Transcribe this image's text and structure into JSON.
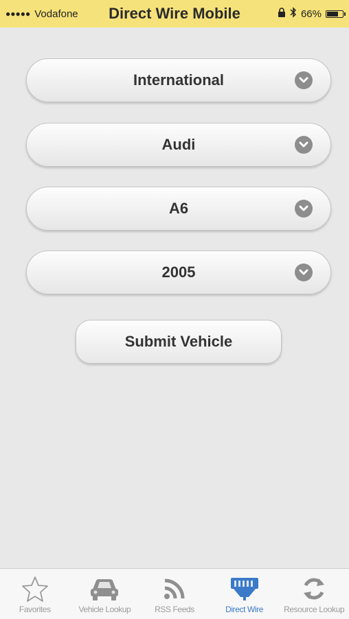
{
  "status_bar": {
    "signal": "●●●●●",
    "carrier": "Vodafone",
    "battery_text": "66%"
  },
  "app_title": "Direct Wire Mobile",
  "dropdowns": [
    {
      "label": "International"
    },
    {
      "label": "Audi"
    },
    {
      "label": "A6"
    },
    {
      "label": "2005"
    }
  ],
  "submit_button": "Submit Vehicle",
  "tabs": [
    {
      "label": "Favorites",
      "icon": "star-icon",
      "active": false
    },
    {
      "label": "Vehicle Lookup",
      "icon": "car-icon",
      "active": false
    },
    {
      "label": "RSS Feeds",
      "icon": "rss-icon",
      "active": false
    },
    {
      "label": "Direct Wire",
      "icon": "direct-wire-icon",
      "active": true
    },
    {
      "label": "Resource Lookup",
      "icon": "refresh-icon",
      "active": false
    }
  ],
  "colors": {
    "status_bar_bg": "#f6e27a",
    "active_tab": "#3b79c9",
    "inactive_tab": "#9a9a9a"
  }
}
